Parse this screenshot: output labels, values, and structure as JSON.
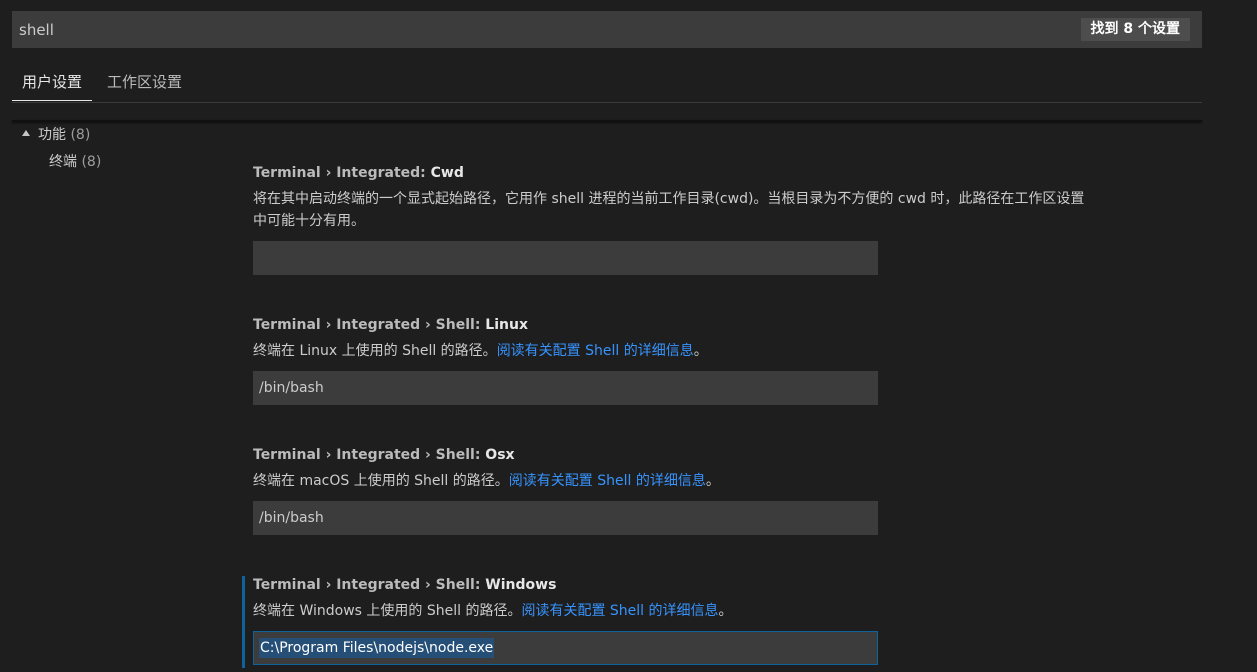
{
  "search": {
    "value": "shell",
    "result_count": "找到 8 个设置"
  },
  "tabs": [
    {
      "label": "用户设置",
      "active": true
    },
    {
      "label": "工作区设置",
      "active": false
    }
  ],
  "toc": {
    "group": {
      "label": "功能",
      "count": "(8)"
    },
    "item": {
      "label": "终端",
      "count": "(8)"
    }
  },
  "settings": [
    {
      "category": "Terminal › Integrated: ",
      "name": "Cwd",
      "description_line1": "将在其中启动终端的一个显式起始路径，它用作 shell 进程的当前工作目录(cwd)。当根目录为不方便的 cwd 时，此路径在工作区设置",
      "description_line2": "中可能十分有用。",
      "value": ""
    },
    {
      "category": "Terminal › Integrated › Shell: ",
      "name": "Linux",
      "description": "终端在 Linux 上使用的 Shell 的路径。",
      "link": "阅读有关配置 Shell 的详细信息",
      "suffix": "。",
      "value": "/bin/bash"
    },
    {
      "category": "Terminal › Integrated › Shell: ",
      "name": "Osx",
      "description": "终端在 macOS 上使用的 Shell 的路径。",
      "link": "阅读有关配置 Shell 的详细信息",
      "suffix": "。",
      "value": "/bin/bash"
    },
    {
      "category": "Terminal › Integrated › Shell: ",
      "name": "Windows",
      "description": "终端在 Windows 上使用的 Shell 的路径。",
      "link": "阅读有关配置 Shell 的详细信息",
      "suffix": "。",
      "value": "C:\\Program Files\\nodejs\\node.exe"
    }
  ],
  "colors": {
    "background": "#1e1e1e",
    "input_background": "#3c3c3c",
    "link": "#3794ff",
    "focus_border": "#0e639c",
    "selection": "#264f78"
  }
}
